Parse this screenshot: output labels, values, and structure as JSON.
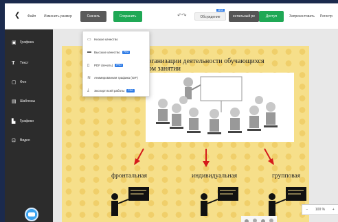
{
  "topbar": {
    "file": "Файл",
    "resize": "Изменить размер",
    "download": "Скачать",
    "save": "Сохранить",
    "comments": "Обсуждение",
    "comments_badge": "NEW",
    "presentation": "ентальный ре",
    "share": "Доступ",
    "present": "Запрезентовать",
    "register": "Регистр"
  },
  "sidebar": {
    "items": [
      {
        "label": "Графика",
        "icon": "image-icon"
      },
      {
        "label": "Текст",
        "icon": "text-icon"
      },
      {
        "label": "Фон",
        "icon": "background-icon"
      },
      {
        "label": "Шаблоны",
        "icon": "templates-icon"
      },
      {
        "label": "Графики",
        "icon": "chart-icon"
      },
      {
        "label": "Видео",
        "icon": "video-icon"
      }
    ]
  },
  "download_menu": {
    "items": [
      {
        "label": "Низкое качество",
        "icon": "file-icon",
        "badge": ""
      },
      {
        "label": "Высокое качество",
        "icon": "hd-icon",
        "badge": "PRO"
      },
      {
        "label": "PDF (печать)",
        "icon": "pdf-icon",
        "badge": "PRO"
      },
      {
        "label": "Анимированная графика (GIF)",
        "icon": "gif-icon",
        "badge": ""
      },
      {
        "label": "Экспорт всей работы",
        "icon": "export-icon",
        "badge": "PRO"
      }
    ]
  },
  "slide": {
    "title_line1": "ы организации деятельности обучающихся",
    "title_line2": "ебном занятии",
    "labels": [
      "фронтальная",
      "индивидуальная",
      "групповая"
    ]
  },
  "zoom": {
    "minus": "−",
    "value": "100 %",
    "plus": "+"
  },
  "colors": {
    "accent_green": "#1fa855",
    "pro_blue": "#2e7be6",
    "sidebar_bg": "#2c2c2c",
    "canvas_bg": "#f6df8a"
  }
}
